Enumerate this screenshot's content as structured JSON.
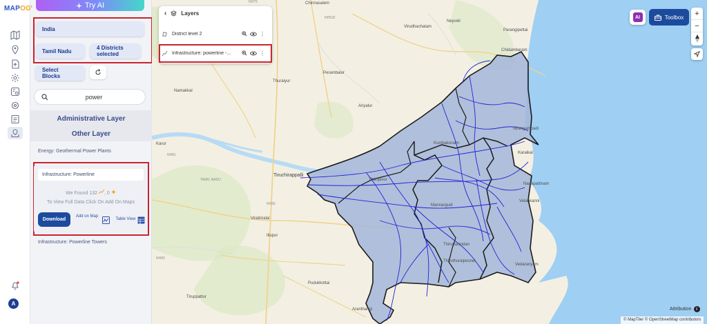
{
  "brand": {
    "logo_main": "MAP",
    "logo_accent": "OG"
  },
  "try_ai": {
    "label": "Try AI"
  },
  "selection": {
    "country": "India",
    "state": "Tamil Nadu",
    "districts": "4 Districts selected",
    "blocks": "Select Blocks"
  },
  "search": {
    "value": "power",
    "placeholder": "Search"
  },
  "sections": {
    "administrative": "Administrative Layer",
    "other": "Other Layer"
  },
  "results": {
    "item1": "Energy: Geothermal Power Plants",
    "card": {
      "name": "Infrastructure: Powerline",
      "found_prefix": "We Found",
      "found_count": "132",
      "found_zero": "0",
      "hint": "To View Full Data Click On Add On Maps",
      "download": "Download",
      "add_on_map": "Add on Map",
      "table_view": "Table View"
    },
    "item2": "Infrastructure: Powerline Towers"
  },
  "user": {
    "avatar_initial": "A"
  },
  "layers": {
    "title": "Layers",
    "items": [
      {
        "name": "District level 2"
      },
      {
        "name": "Infrastructure: powerline -..."
      }
    ]
  },
  "map_controls": {
    "toolbox": "Toolbox",
    "ai_badge": "AI",
    "zoom_in": "+",
    "zoom_out": "−",
    "attribution": "Attribution",
    "copyright": "© MapTiler © OpenStreetMap contributors"
  },
  "map_labels": {
    "namakkal": "Namakkal",
    "karur": "Karur",
    "tiruchirappalli": "Tiruchirappalli",
    "tamil_nadu": "TAMIL NADU",
    "thanjavur": "Thanjavur",
    "kumbakonam": "Kumbakonam",
    "ariyalur": "Ariyalur",
    "chidambaram": "Chidambaram",
    "parangipettai": "Parangipettai",
    "virudhachalam": "Virudhachalam",
    "neyveli": "Neyveli",
    "tarangambadi": "Tarangambadi",
    "karaikal": "Karaikal",
    "nagapattinam": "Nagapattinam",
    "velankanni": "Velankanni",
    "mannargudi": "Mannargudi",
    "thiruvalandan": "Thiruvalandan",
    "thiruthuraipoondi": "Thiruthuraipoondi",
    "vedaranyam": "Vedaranyam",
    "viralimalai": "Viralimalai",
    "pudukkottai": "Pudukkottai",
    "illupur": "Illupur",
    "aranthangi": "Aranthangi",
    "tiruppattur": "Tiruppattur",
    "thuraiyur": "Thuraiyur",
    "perambalur": "Perambalur",
    "chinnasalem": "Chinnasalem",
    "nh81": "NH81",
    "nh36": "NH36",
    "nh83": "NH83",
    "nh532": "NH532",
    "nh79": "NH79"
  },
  "colors": {
    "primary": "#1c4b9e",
    "highlight": "#c9232c",
    "region_fill": "#a3b6d9",
    "powerline": "#2323d8",
    "sea": "#9fcff3",
    "land": "#f3f0e3"
  }
}
